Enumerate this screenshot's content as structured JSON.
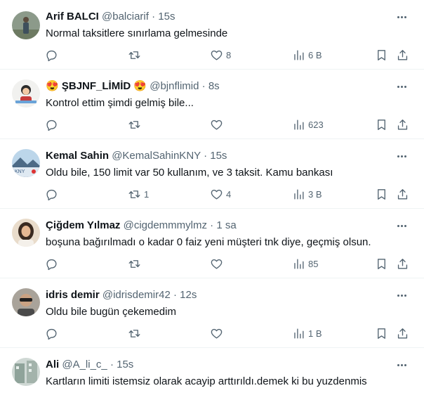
{
  "tweets": [
    {
      "name": "Arif BALCI",
      "handle": "@balciarif",
      "dot": "·",
      "time": "15s",
      "text": "Normal taksitlere sınırlama gelmesinde",
      "replies": "",
      "retweets": "",
      "likes": "8",
      "views": "6 B",
      "avatar_icon": "person-standing-avatar"
    },
    {
      "name": "ŞBJNF_LİMİD",
      "name_emoji": "😍",
      "handle": "@bjnflimid",
      "dot": "·",
      "time": "8s",
      "text": "Kontrol ettim şimdi gelmiş bile...",
      "replies": "",
      "retweets": "",
      "likes": "",
      "views": "623",
      "avatar_icon": "cartoon-character-avatar"
    },
    {
      "name": "Kemal Sahin",
      "handle": "@KemalSahinKNY",
      "dot": "·",
      "time": "15s",
      "text": "Oldu bile, 150 limit var 50 kullanım, ve 3 taksit. Kamu bankası",
      "replies": "",
      "retweets": "1",
      "likes": "4",
      "views": "3 B",
      "avatar_icon": "landscape-avatar"
    },
    {
      "name": "Çiğdem Yılmaz",
      "handle": "@cigdemmmylmz",
      "dot": "·",
      "time": "1 sa",
      "text": "boşuna bağırılmadı o kadar 0 faiz yeni müşteri tnk diye, geçmiş olsun.",
      "replies": "",
      "retweets": "",
      "likes": "",
      "views": "85",
      "avatar_icon": "woman-portrait-avatar"
    },
    {
      "name": "idris demir",
      "handle": "@idrisdemir42",
      "dot": "·",
      "time": "12s",
      "text": "Oldu bile bugün çekemedim",
      "replies": "",
      "retweets": "",
      "likes": "",
      "views": "1 B",
      "avatar_icon": "man-sunglasses-avatar"
    },
    {
      "name": "Ali",
      "handle": "@A_li_c_",
      "dot": "·",
      "time": "15s",
      "text": "Kartların limiti istemsiz olarak acayip arttırıldı.demek ki bu yuzdenmis",
      "replies": "",
      "retweets": "",
      "likes": "",
      "views": "",
      "avatar_icon": "building-avatar"
    }
  ],
  "colors": {
    "text": "#0f1419",
    "secondary": "#536471",
    "divider": "#eff3f4"
  }
}
